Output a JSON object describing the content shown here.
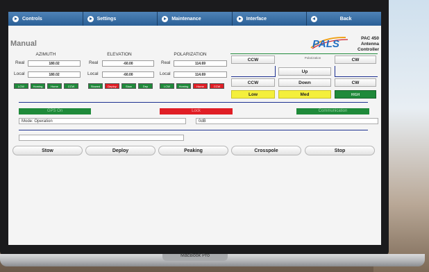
{
  "laptop": {
    "brand": "MacBook Pro"
  },
  "nav": {
    "tabs": [
      {
        "label": "Controls"
      },
      {
        "label": "Settings"
      },
      {
        "label": "Maintenance"
      },
      {
        "label": "Interface"
      },
      {
        "label": "Back"
      }
    ]
  },
  "page": {
    "title": "Manual"
  },
  "logo": {
    "text": "PALS",
    "accent": "#1f6fc2"
  },
  "product": {
    "line1": "PAC 450",
    "line2": "Antenna",
    "line3": "Controller"
  },
  "axes": {
    "azimuth": {
      "title": "AZIMUTH",
      "real_label": "Real",
      "real_value": "180.02",
      "local_label": "Local",
      "local_value": "180.02",
      "status": [
        {
          "label": "LCW",
          "color": "green"
        },
        {
          "label": "Homing",
          "color": "green"
        },
        {
          "label": "Home",
          "color": "green"
        },
        {
          "label": "CCW",
          "color": "green"
        }
      ]
    },
    "elevation": {
      "title": "ELEVATION",
      "real_label": "Real",
      "real_value": "-60.00",
      "local_label": "Local",
      "local_value": "-60.00",
      "status": [
        {
          "label": "Stowed",
          "color": "green"
        },
        {
          "label": "Deploy",
          "color": "red"
        },
        {
          "label": "Stow",
          "color": "green"
        },
        {
          "label": "Dep",
          "color": "green"
        }
      ]
    },
    "polarization": {
      "title": "POLARIZATION",
      "real_label": "Real",
      "real_value": "114.69",
      "local_label": "Local",
      "local_value": "114.69",
      "status": [
        {
          "label": "LCW",
          "color": "green"
        },
        {
          "label": "Homing",
          "color": "green"
        },
        {
          "label": "Home",
          "color": "red"
        },
        {
          "label": "CCW",
          "color": "red"
        }
      ]
    }
  },
  "pol_controls": {
    "ccw_top": "CCW",
    "label": "Polarization",
    "cw_top": "CW",
    "up": "Up",
    "ccw_mid": "CCW",
    "down": "Down",
    "cw_mid": "CW",
    "low": "Low",
    "med": "Med",
    "high": "HIGH"
  },
  "indicators": {
    "gps": "GPS On",
    "lock": "Lock",
    "communication": "Communication"
  },
  "mode_field": {
    "value": "Mode:  Operation"
  },
  "db_field": {
    "value": "0dB"
  },
  "actions": [
    {
      "label": "Stow"
    },
    {
      "label": "Deploy"
    },
    {
      "label": "Peaking"
    },
    {
      "label": "Crosspole"
    },
    {
      "label": "Stop"
    }
  ],
  "colors": {
    "nav_blue": "#2a5f96",
    "status_green": "#1f8a3a",
    "status_red": "#e01e25",
    "speed_yellow": "#f4ef3c",
    "divider_blue": "#1b2f8f"
  }
}
